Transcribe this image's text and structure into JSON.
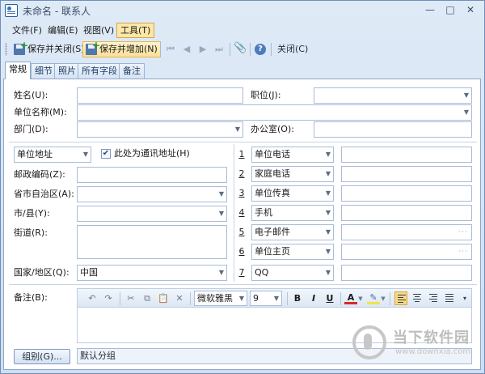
{
  "window": {
    "title": "未命名 - 联系人"
  },
  "menu": [
    {
      "label": "文件(F)"
    },
    {
      "label": "编辑(E)"
    },
    {
      "label": "视图(V)"
    },
    {
      "label": "工具(T)"
    }
  ],
  "toolbar": {
    "save_close": "保存并关闭(S)",
    "save_add": "保存并增加(N)",
    "close": "关闭(C)"
  },
  "tabs": [
    {
      "label": "常规"
    },
    {
      "label": "细节"
    },
    {
      "label": "照片"
    },
    {
      "label": "所有字段"
    },
    {
      "label": "备注"
    }
  ],
  "form": {
    "name_label": "姓名(U):",
    "position_label": "职位(J):",
    "company_label": "单位名称(M):",
    "dept_label": "部门(D):",
    "office_label": "办公室(O):",
    "address_type": "单位地址",
    "mailing_checkbox": "此处为通讯地址(H)",
    "postcode_label": "邮政编码(Z):",
    "province_label": "省市自治区(A):",
    "city_label": "市/县(Y):",
    "street_label": "街道(R):",
    "country_label": "国家/地区(Q):",
    "country_value": "中国"
  },
  "contacts": [
    {
      "num": "1",
      "type": "单位电话"
    },
    {
      "num": "2",
      "type": "家庭电话"
    },
    {
      "num": "3",
      "type": "单位传真"
    },
    {
      "num": "4",
      "type": "手机"
    },
    {
      "num": "5",
      "type": "电子邮件"
    },
    {
      "num": "6",
      "type": "单位主页"
    },
    {
      "num": "7",
      "type": "QQ"
    }
  ],
  "notes": {
    "label": "备注(B):",
    "font": "微软雅黑",
    "size": "9",
    "bold": "B",
    "italic": "I",
    "underline": "U",
    "font_color_glyph": "A"
  },
  "group": {
    "button": "组别(G)...",
    "value": "默认分组"
  },
  "watermark": {
    "text": "当下软件园",
    "url": "www.downxia.com"
  }
}
